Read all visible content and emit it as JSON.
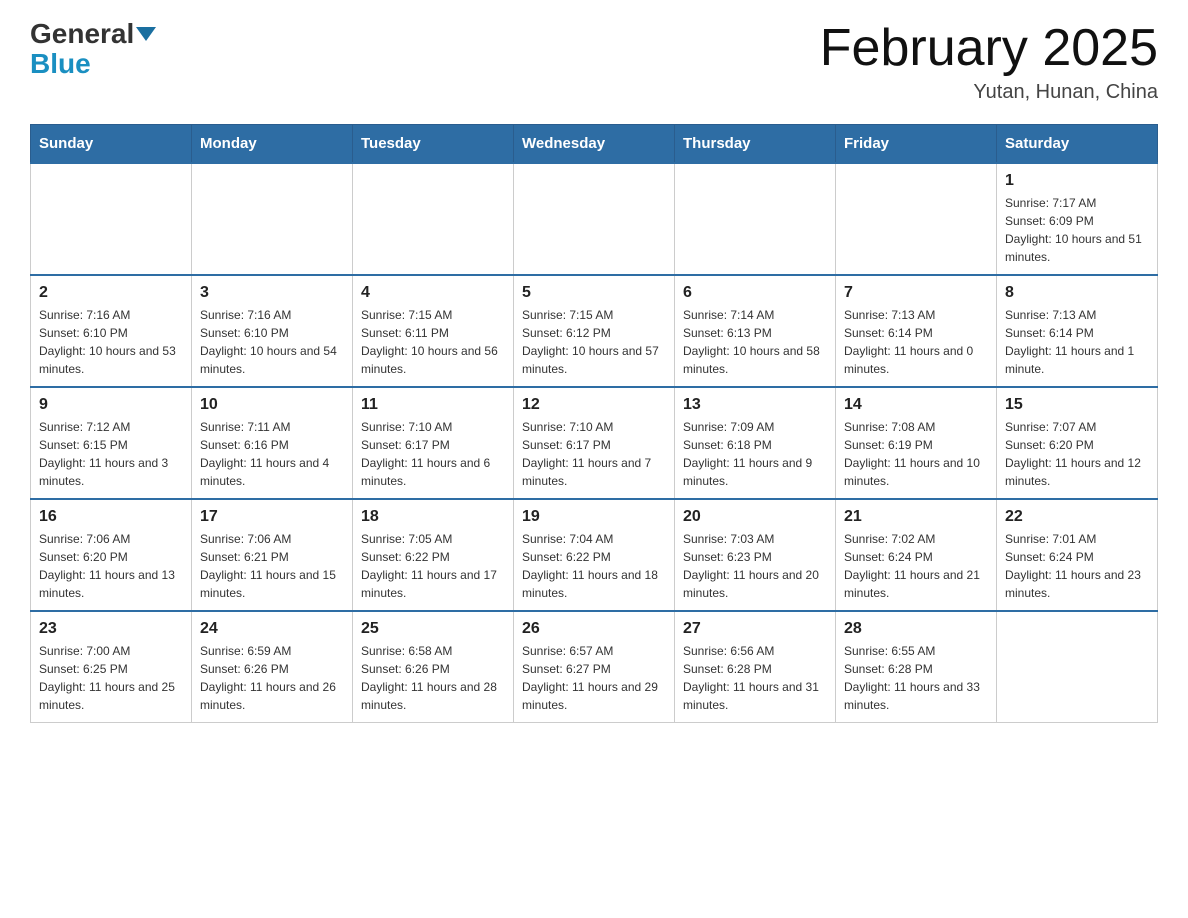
{
  "header": {
    "logo_general": "General",
    "logo_blue": "Blue",
    "calendar_title": "February 2025",
    "calendar_subtitle": "Yutan, Hunan, China"
  },
  "days_of_week": [
    "Sunday",
    "Monday",
    "Tuesday",
    "Wednesday",
    "Thursday",
    "Friday",
    "Saturday"
  ],
  "weeks": [
    [
      {
        "day": "",
        "sunrise": "",
        "sunset": "",
        "daylight": ""
      },
      {
        "day": "",
        "sunrise": "",
        "sunset": "",
        "daylight": ""
      },
      {
        "day": "",
        "sunrise": "",
        "sunset": "",
        "daylight": ""
      },
      {
        "day": "",
        "sunrise": "",
        "sunset": "",
        "daylight": ""
      },
      {
        "day": "",
        "sunrise": "",
        "sunset": "",
        "daylight": ""
      },
      {
        "day": "",
        "sunrise": "",
        "sunset": "",
        "daylight": ""
      },
      {
        "day": "1",
        "sunrise": "Sunrise: 7:17 AM",
        "sunset": "Sunset: 6:09 PM",
        "daylight": "Daylight: 10 hours and 51 minutes."
      }
    ],
    [
      {
        "day": "2",
        "sunrise": "Sunrise: 7:16 AM",
        "sunset": "Sunset: 6:10 PM",
        "daylight": "Daylight: 10 hours and 53 minutes."
      },
      {
        "day": "3",
        "sunrise": "Sunrise: 7:16 AM",
        "sunset": "Sunset: 6:10 PM",
        "daylight": "Daylight: 10 hours and 54 minutes."
      },
      {
        "day": "4",
        "sunrise": "Sunrise: 7:15 AM",
        "sunset": "Sunset: 6:11 PM",
        "daylight": "Daylight: 10 hours and 56 minutes."
      },
      {
        "day": "5",
        "sunrise": "Sunrise: 7:15 AM",
        "sunset": "Sunset: 6:12 PM",
        "daylight": "Daylight: 10 hours and 57 minutes."
      },
      {
        "day": "6",
        "sunrise": "Sunrise: 7:14 AM",
        "sunset": "Sunset: 6:13 PM",
        "daylight": "Daylight: 10 hours and 58 minutes."
      },
      {
        "day": "7",
        "sunrise": "Sunrise: 7:13 AM",
        "sunset": "Sunset: 6:14 PM",
        "daylight": "Daylight: 11 hours and 0 minutes."
      },
      {
        "day": "8",
        "sunrise": "Sunrise: 7:13 AM",
        "sunset": "Sunset: 6:14 PM",
        "daylight": "Daylight: 11 hours and 1 minute."
      }
    ],
    [
      {
        "day": "9",
        "sunrise": "Sunrise: 7:12 AM",
        "sunset": "Sunset: 6:15 PM",
        "daylight": "Daylight: 11 hours and 3 minutes."
      },
      {
        "day": "10",
        "sunrise": "Sunrise: 7:11 AM",
        "sunset": "Sunset: 6:16 PM",
        "daylight": "Daylight: 11 hours and 4 minutes."
      },
      {
        "day": "11",
        "sunrise": "Sunrise: 7:10 AM",
        "sunset": "Sunset: 6:17 PM",
        "daylight": "Daylight: 11 hours and 6 minutes."
      },
      {
        "day": "12",
        "sunrise": "Sunrise: 7:10 AM",
        "sunset": "Sunset: 6:17 PM",
        "daylight": "Daylight: 11 hours and 7 minutes."
      },
      {
        "day": "13",
        "sunrise": "Sunrise: 7:09 AM",
        "sunset": "Sunset: 6:18 PM",
        "daylight": "Daylight: 11 hours and 9 minutes."
      },
      {
        "day": "14",
        "sunrise": "Sunrise: 7:08 AM",
        "sunset": "Sunset: 6:19 PM",
        "daylight": "Daylight: 11 hours and 10 minutes."
      },
      {
        "day": "15",
        "sunrise": "Sunrise: 7:07 AM",
        "sunset": "Sunset: 6:20 PM",
        "daylight": "Daylight: 11 hours and 12 minutes."
      }
    ],
    [
      {
        "day": "16",
        "sunrise": "Sunrise: 7:06 AM",
        "sunset": "Sunset: 6:20 PM",
        "daylight": "Daylight: 11 hours and 13 minutes."
      },
      {
        "day": "17",
        "sunrise": "Sunrise: 7:06 AM",
        "sunset": "Sunset: 6:21 PM",
        "daylight": "Daylight: 11 hours and 15 minutes."
      },
      {
        "day": "18",
        "sunrise": "Sunrise: 7:05 AM",
        "sunset": "Sunset: 6:22 PM",
        "daylight": "Daylight: 11 hours and 17 minutes."
      },
      {
        "day": "19",
        "sunrise": "Sunrise: 7:04 AM",
        "sunset": "Sunset: 6:22 PM",
        "daylight": "Daylight: 11 hours and 18 minutes."
      },
      {
        "day": "20",
        "sunrise": "Sunrise: 7:03 AM",
        "sunset": "Sunset: 6:23 PM",
        "daylight": "Daylight: 11 hours and 20 minutes."
      },
      {
        "day": "21",
        "sunrise": "Sunrise: 7:02 AM",
        "sunset": "Sunset: 6:24 PM",
        "daylight": "Daylight: 11 hours and 21 minutes."
      },
      {
        "day": "22",
        "sunrise": "Sunrise: 7:01 AM",
        "sunset": "Sunset: 6:24 PM",
        "daylight": "Daylight: 11 hours and 23 minutes."
      }
    ],
    [
      {
        "day": "23",
        "sunrise": "Sunrise: 7:00 AM",
        "sunset": "Sunset: 6:25 PM",
        "daylight": "Daylight: 11 hours and 25 minutes."
      },
      {
        "day": "24",
        "sunrise": "Sunrise: 6:59 AM",
        "sunset": "Sunset: 6:26 PM",
        "daylight": "Daylight: 11 hours and 26 minutes."
      },
      {
        "day": "25",
        "sunrise": "Sunrise: 6:58 AM",
        "sunset": "Sunset: 6:26 PM",
        "daylight": "Daylight: 11 hours and 28 minutes."
      },
      {
        "day": "26",
        "sunrise": "Sunrise: 6:57 AM",
        "sunset": "Sunset: 6:27 PM",
        "daylight": "Daylight: 11 hours and 29 minutes."
      },
      {
        "day": "27",
        "sunrise": "Sunrise: 6:56 AM",
        "sunset": "Sunset: 6:28 PM",
        "daylight": "Daylight: 11 hours and 31 minutes."
      },
      {
        "day": "28",
        "sunrise": "Sunrise: 6:55 AM",
        "sunset": "Sunset: 6:28 PM",
        "daylight": "Daylight: 11 hours and 33 minutes."
      },
      {
        "day": "",
        "sunrise": "",
        "sunset": "",
        "daylight": ""
      }
    ]
  ]
}
